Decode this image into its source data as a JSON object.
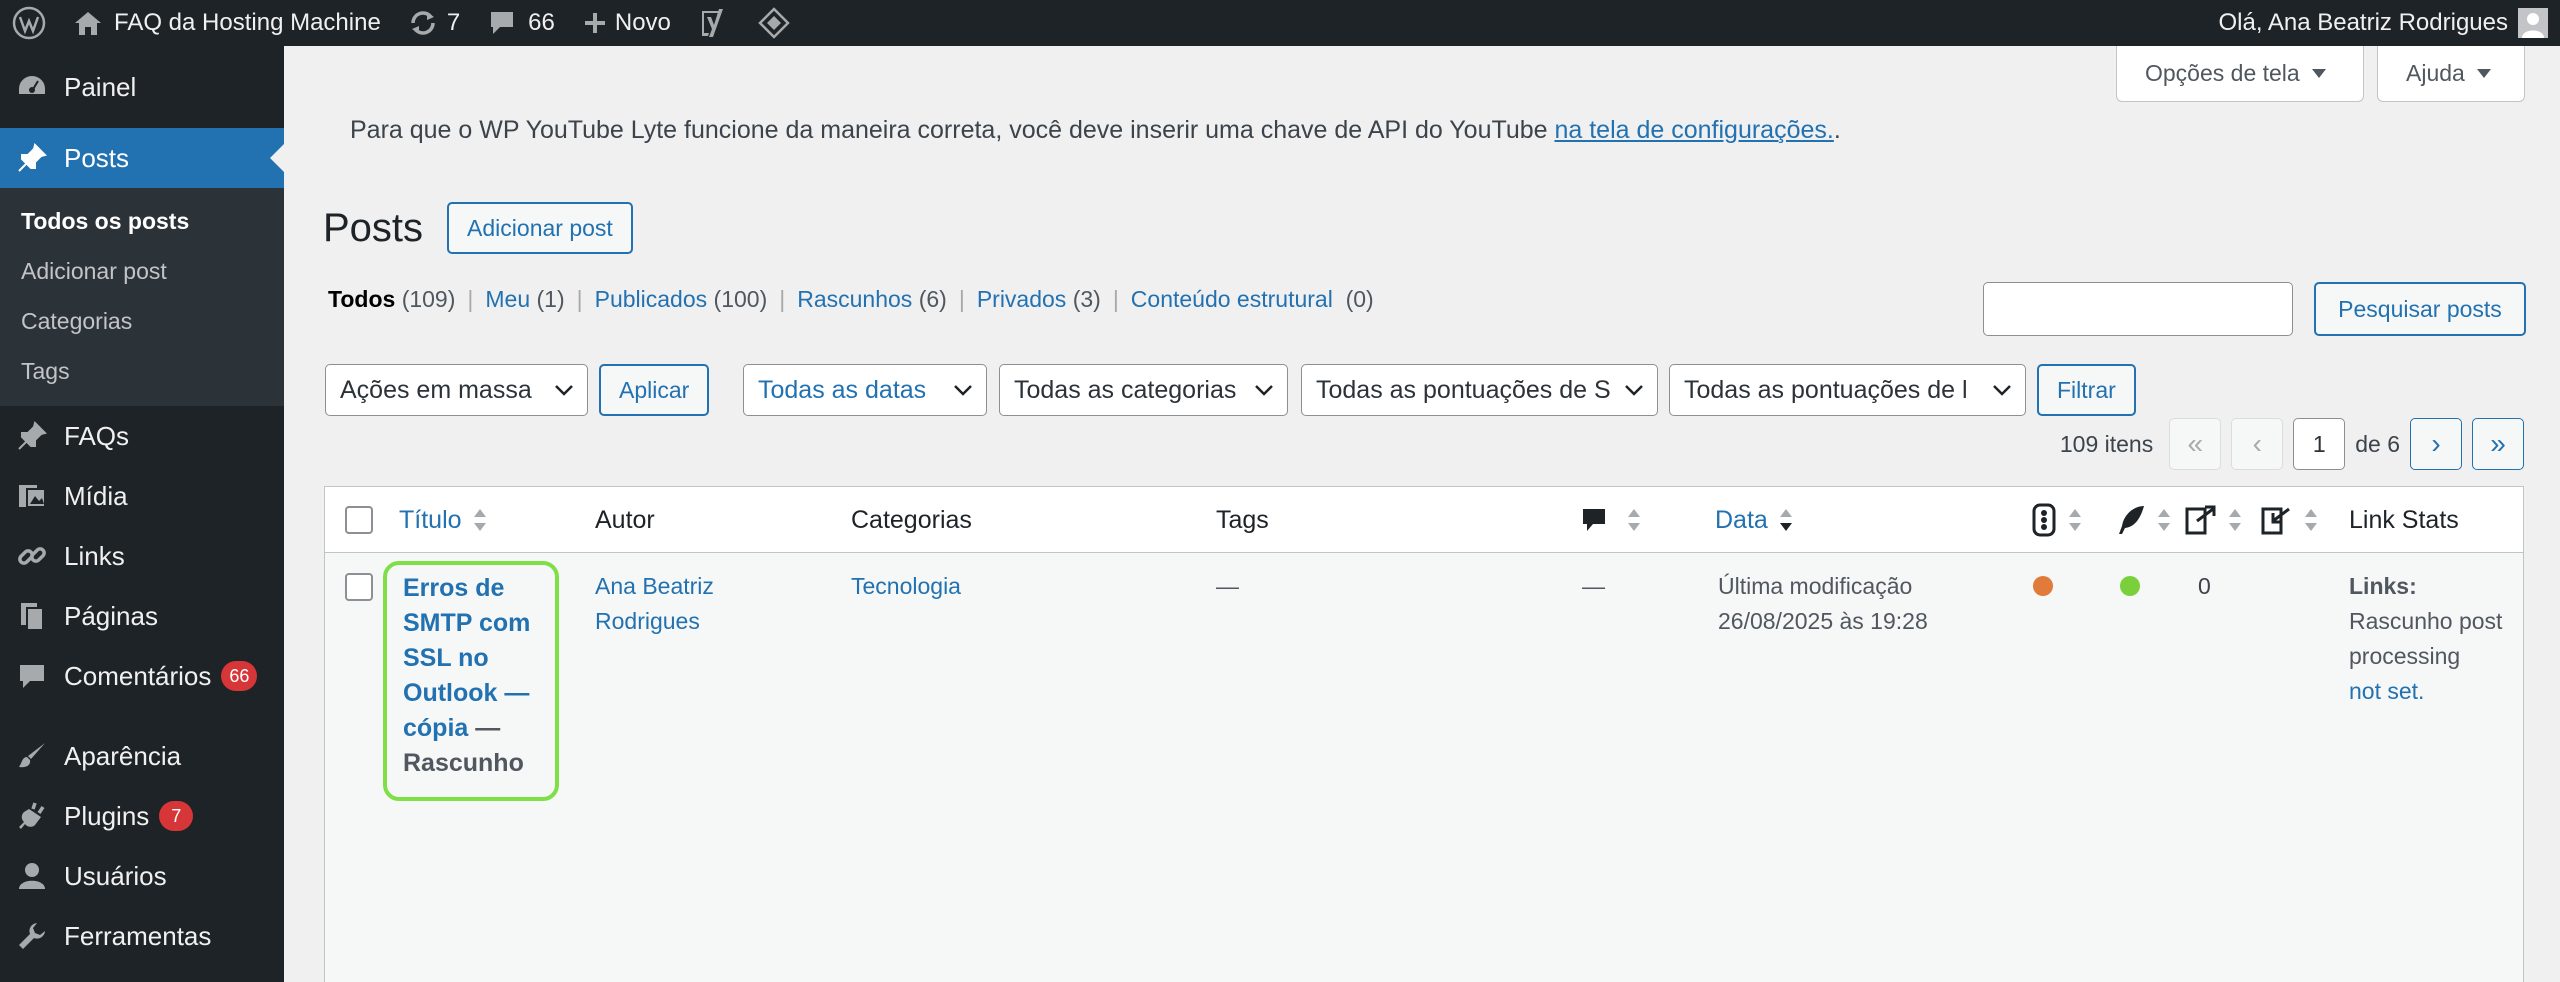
{
  "adminbar": {
    "site_name": "FAQ da Hosting Machine",
    "updates_count": "7",
    "comments_count": "66",
    "new_label": "Novo",
    "greeting": "Olá, Ana Beatriz Rodrigues"
  },
  "sidebar": {
    "items": [
      {
        "label": "Painel",
        "icon": "dashboard-icon"
      },
      {
        "label": "Posts",
        "icon": "pin-icon"
      },
      {
        "label": "FAQs",
        "icon": "pin-icon"
      },
      {
        "label": "Mídia",
        "icon": "media-icon"
      },
      {
        "label": "Links",
        "icon": "link-icon"
      },
      {
        "label": "Páginas",
        "icon": "page-icon"
      },
      {
        "label": "Comentários",
        "icon": "comment-icon",
        "badge": "66"
      },
      {
        "label": "Aparência",
        "icon": "brush-icon"
      },
      {
        "label": "Plugins",
        "icon": "plugin-icon",
        "badge": "7"
      },
      {
        "label": "Usuários",
        "icon": "user-icon"
      },
      {
        "label": "Ferramentas",
        "icon": "wrench-icon"
      }
    ],
    "submenu": [
      "Todos os posts",
      "Adicionar post",
      "Categorias",
      "Tags"
    ]
  },
  "screen_meta": {
    "options_label": "Opções de tela",
    "help_label": "Ajuda"
  },
  "notice": {
    "text": "Para que o WP YouTube Lyte funcione da maneira correta, você deve inserir uma chave de API do YouTube ",
    "link_text": "na tela de configurações.",
    "suffix": "."
  },
  "page": {
    "title": "Posts",
    "add_button": "Adicionar post"
  },
  "views": [
    {
      "label": "Todos",
      "count": "(109)"
    },
    {
      "label": "Meu",
      "count": "(1)"
    },
    {
      "label": "Publicados",
      "count": "(100)"
    },
    {
      "label": "Rascunhos",
      "count": "(6)"
    },
    {
      "label": "Privados",
      "count": "(3)"
    },
    {
      "label": "Conteúdo estrutural",
      "count": "(0)"
    }
  ],
  "search": {
    "value": "",
    "button_label": "Pesquisar posts"
  },
  "filters": {
    "bulk_actions": "Ações em massa",
    "apply_label": "Aplicar",
    "dates": "Todas as datas",
    "categories": "Todas as categorias",
    "seo_scores": "Todas as pontuações de S",
    "readability_scores": "Todas as pontuações de l",
    "filter_label": "Filtrar"
  },
  "pagination": {
    "items": "109 itens",
    "first": "«",
    "prev": "‹",
    "current_page": "1",
    "of_pages": "de 6",
    "next": "›",
    "last": "»"
  },
  "table": {
    "headers": {
      "title": "Título",
      "author": "Autor",
      "categories": "Categorias",
      "tags": "Tags",
      "date": "Data",
      "link_stats": "Link Stats"
    },
    "rows": [
      {
        "title": "Erros de SMTP com SSL no Outlook — cópia",
        "state": "— Rascunho",
        "author": "Ana Beatriz Rodrigues",
        "category": "Tecnologia",
        "tags": "—",
        "comments": "—",
        "date_label": "Última modificação",
        "date_value": "26/08/2025 às 19:28",
        "seo_color": "#e07b39",
        "readability_color": "#7ad03a",
        "outgoing_links": "0",
        "link_stats_label": "Links:",
        "link_stats_text": "Rascunho post processing",
        "link_stats_link": "not set."
      }
    ]
  }
}
